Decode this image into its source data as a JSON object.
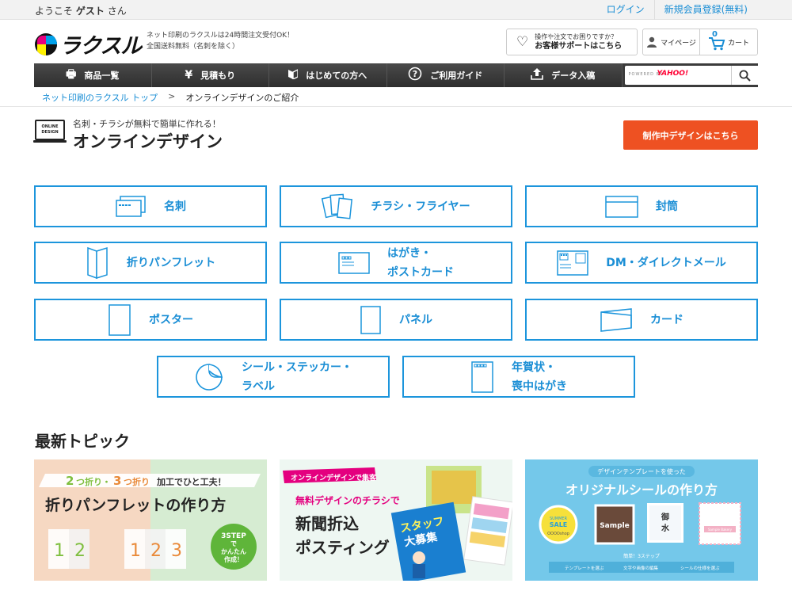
{
  "topbar": {
    "welcome_prefix": "ようこそ",
    "welcome_name": "ゲスト",
    "welcome_suffix": "さん",
    "login": "ログイン",
    "register": "新規会員登録(無料)"
  },
  "header": {
    "logo_text": "ラクスル",
    "tagline_1": "ネット印刷のラクスルは24時間注文受付OK！",
    "tagline_2": "全国送料無料（名刺を除く）",
    "support_line1": "操作や注文でお困りですか？",
    "support_line2": "お客様サポートはこちら",
    "mypage": "マイページ",
    "cart_count": "0",
    "cart": "カート"
  },
  "nav": {
    "items": [
      {
        "label": "商品一覧",
        "icon": "printer-icon"
      },
      {
        "label": "見積もり",
        "icon": "yen-icon"
      },
      {
        "label": "はじめての方へ",
        "icon": "beginner-icon"
      },
      {
        "label": "ご利用ガイド",
        "icon": "question-icon"
      },
      {
        "label": "データ入稿",
        "icon": "upload-icon"
      }
    ],
    "search_powered": "POWERED BY",
    "search_brand": "YAHOO!"
  },
  "breadcrumb": {
    "home": "ネット印刷のラクスル トップ",
    "separator": ">",
    "current": "オンラインデザインのご紹介"
  },
  "title": {
    "icon_line1": "ONLINE",
    "icon_line2": "DESIGN",
    "subtitle": "名刺・チラシが無料で簡単に作れる！",
    "heading": "オンラインデザイン",
    "cta": "制作中デザインはこちら"
  },
  "categories": [
    {
      "label": "名刺",
      "icon": "business-card-icon"
    },
    {
      "label": "チラシ・フライヤー",
      "icon": "flyer-icon"
    },
    {
      "label": "封筒",
      "icon": "envelope-icon"
    },
    {
      "label": "折りパンフレット",
      "icon": "folded-pamphlet-icon"
    },
    {
      "label": "はがき・\nポストカード",
      "icon": "postcard-icon"
    },
    {
      "label": "DM・ダイレクトメール",
      "icon": "direct-mail-icon"
    },
    {
      "label": "ポスター",
      "icon": "poster-icon"
    },
    {
      "label": "パネル",
      "icon": "panel-icon"
    },
    {
      "label": "カード",
      "icon": "card-icon"
    },
    {
      "label": "シール・ステッカー・\nラベル",
      "icon": "sticker-icon"
    },
    {
      "label": "年賀状・\n喪中はがき",
      "icon": "new-year-card-icon"
    }
  ],
  "topics": {
    "heading": "最新トピック",
    "banners": [
      {
        "top_line_a": "2",
        "top_line_b": "つ折り・",
        "top_line_c": "3",
        "top_line_d": "つ折り",
        "top_line_e": "加工でひと工夫！",
        "title": "折りパンフレットの作り方",
        "n1": "1",
        "n2": "2",
        "m1": "1",
        "m2": "2",
        "m3": "3",
        "badge_1": "3STEP",
        "badge_2": "で",
        "badge_3": "かんたん",
        "badge_4": "作成！"
      },
      {
        "tag": "オンラインデザインで集客",
        "line1": "無料デザインのチラシで",
        "line2": "新聞折込",
        "line3": "ポスティング",
        "flyer_1": "スタッフ",
        "flyer_2": "大募集"
      },
      {
        "ribbon": "デザインテンプレートを使った",
        "title": "オリジナルシールの作り方",
        "s1_1": "SUMMER",
        "s1_2": "SALE",
        "s1_3": "OOOOshop",
        "s2": "Sample",
        "s3_1": "御",
        "s3_2": "水",
        "s4": "Sample Bakery",
        "steps_title": "簡単！3ステップ",
        "step1": "テンプレートを選ぶ",
        "step2": "文字や画像の編集",
        "step3": "シールの仕様を選ぶ"
      }
    ]
  },
  "colors": {
    "accent_blue": "#1c95dc",
    "cta_orange": "#ee5122",
    "nav_dark": "#3b3b3b"
  }
}
